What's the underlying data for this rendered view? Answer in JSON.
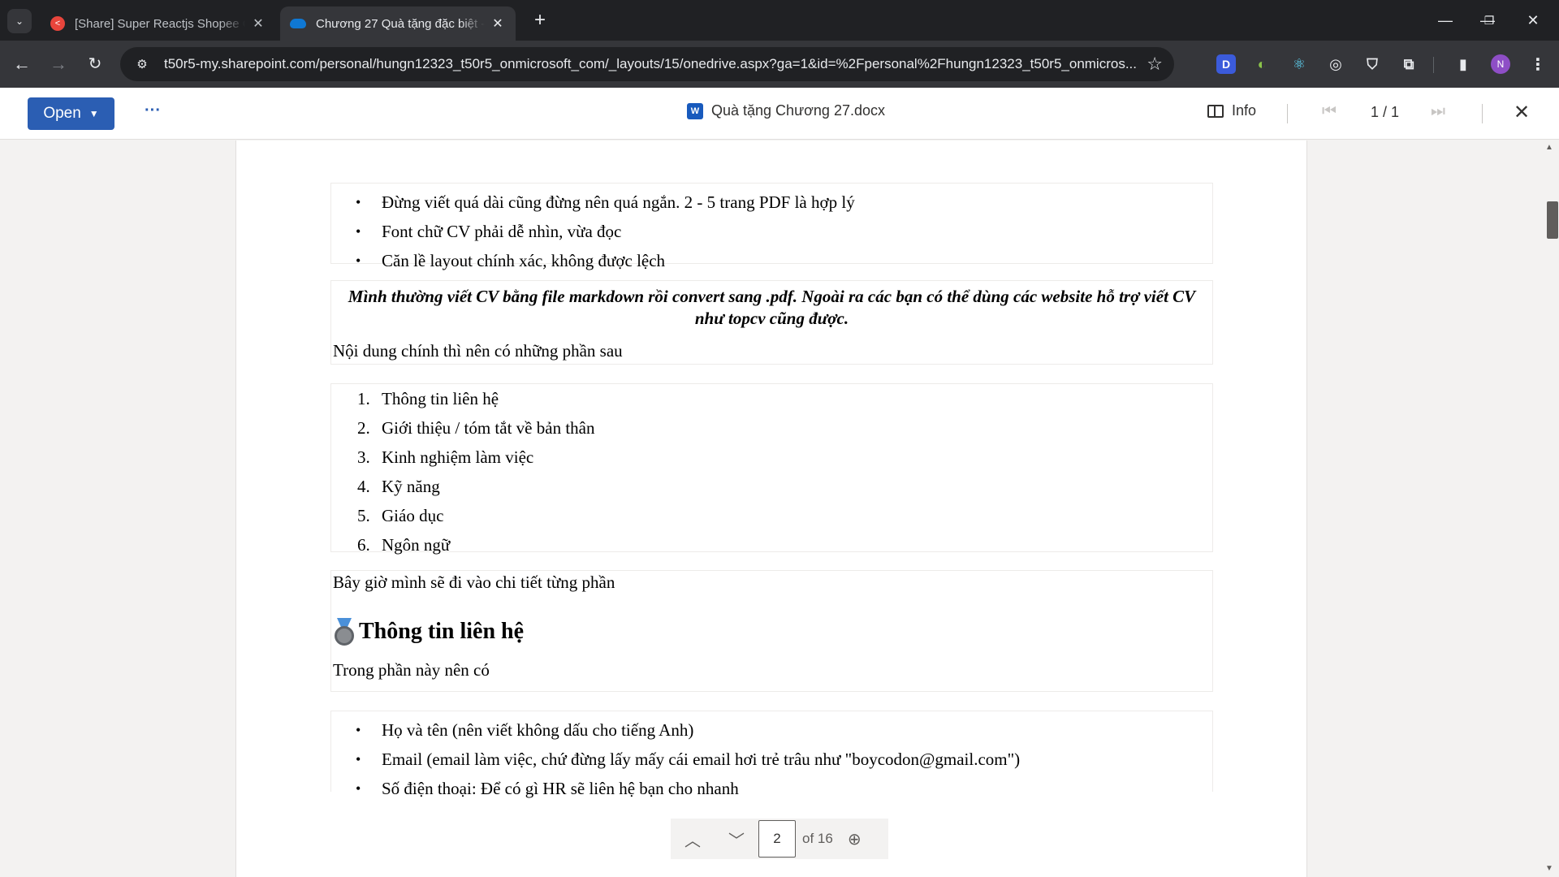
{
  "browser": {
    "tabs": [
      {
        "title": "[Share] Super Reactjs Shopee C",
        "favicon": "share-icon",
        "active": false
      },
      {
        "title": "Chương 27 Quà tặng đặc biệt -",
        "favicon": "onedrive-icon",
        "active": true
      }
    ],
    "url": "t50r5-my.sharepoint.com/personal/hungn12323_t50r5_onmicrosoft_com/_layouts/15/onedrive.aspx?ga=1&id=%2Fpersonal%2Fhungn12323_t50r5_onmicros...",
    "profile_initial": "N",
    "extensions": [
      "D",
      "🎨",
      "⚛",
      "🧭",
      "🛡",
      "puzzle"
    ]
  },
  "viewer": {
    "open_label": "Open",
    "more_label": "···",
    "file_name": "Quà tặng Chương 27.docx",
    "info_label": "Info",
    "page_counter": "1 / 1"
  },
  "document": {
    "bullets_top": [
      "Đừng viết quá dài cũng đừng nên quá ngắn. 2 - 5 trang PDF là hợp lý",
      "Font chữ CV phải dễ nhìn, vừa đọc",
      "Căn lề layout chính xác, không được lệch"
    ],
    "highlight_note": "Mình thường viết CV bằng file markdown rồi convert sang .pdf. Ngoài ra các bạn có thể dùng các website hỗ trợ viết CV như topcv cũng được.",
    "main_content_intro": "Nội dung chính thì nên có những phần sau",
    "sections": [
      {
        "num": "1.",
        "text": "Thông tin liên hệ"
      },
      {
        "num": "2.",
        "text": "Giới thiệu / tóm tắt về bản thân"
      },
      {
        "num": "3.",
        "text": "Kinh nghiệm làm việc"
      },
      {
        "num": "4.",
        "text": "Kỹ năng"
      },
      {
        "num": "5.",
        "text": "Giáo dục"
      },
      {
        "num": "6.",
        "text": "Ngôn ngữ"
      }
    ],
    "detail_intro": "Bây giờ mình sẽ đi vào chi tiết từng phần",
    "heading_contact": "Thông tin liên hệ",
    "contact_intro": "Trong phần này nên có",
    "contact_bullets": [
      "Họ và tên (nên viết không dấu cho tiếng Anh)",
      "Email (email làm việc, chứ đừng lấy mấy cái email hơi trẻ trâu như \"boycodon@gmail.com\")",
      "Số điện thoại: Để có gì HR sẽ liên hệ bạn cho nhanh"
    ]
  },
  "page_nav": {
    "current": "2",
    "of_label": "of 16"
  }
}
